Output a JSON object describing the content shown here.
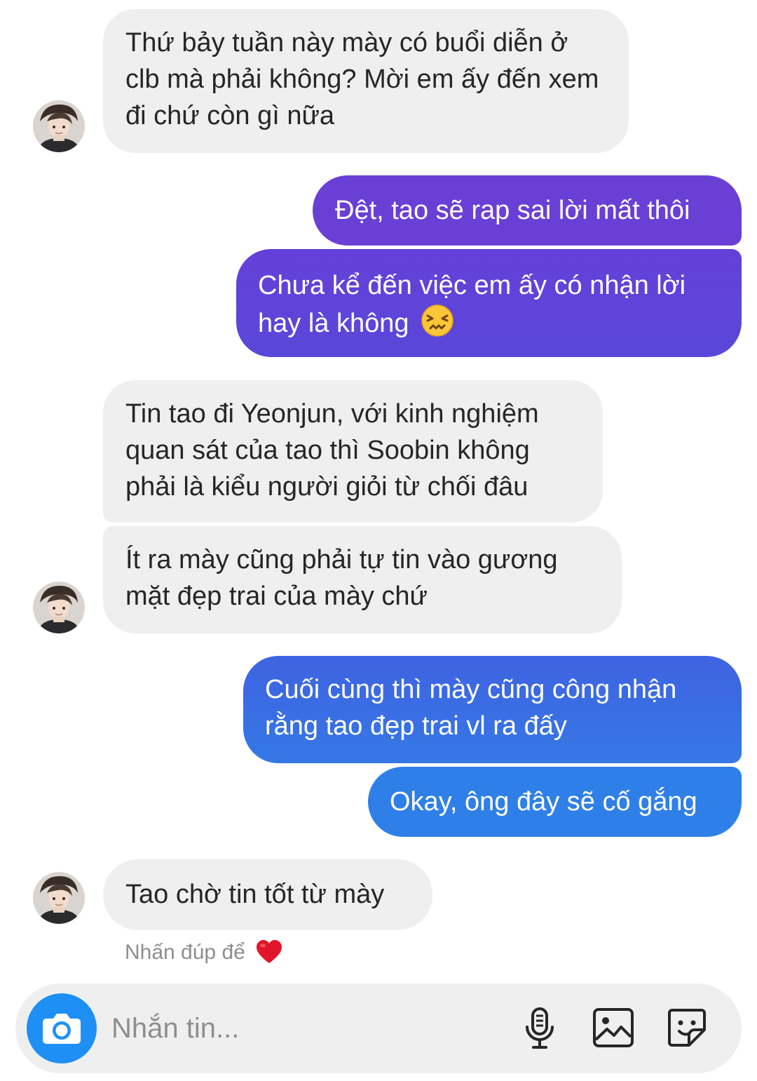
{
  "messages": [
    {
      "text": "Thứ bảy tuần này mày có buổi diễn ở clb mà phải không? Mời em ấy đến xem đi chứ còn gì nữa"
    },
    {
      "text": "Đệt, tao sẽ rap sai lời mất thôi"
    },
    {
      "text": "Chưa kể đến việc em ấy có nhận lời hay là không",
      "emoji": "confounded-face"
    },
    {
      "text": "Tin tao đi Yeonjun, với kinh nghiệm quan sát của tao thì Soobin không phải là kiểu người giỏi từ chối đâu"
    },
    {
      "text": "Ít ra mày cũng phải tự tin vào gương mặt đẹp trai của mày chứ"
    },
    {
      "text": "Cuối cùng thì mày cũng công nhận rằng tao đẹp trai vl ra đấy"
    },
    {
      "text": "Okay, ông đây sẽ cố gắng"
    },
    {
      "text": "Tao chờ tin tốt từ mày"
    }
  ],
  "double_tap_hint": "Nhấn đúp để",
  "composer": {
    "placeholder": "Nhắn tin...",
    "icons": [
      "camera-icon",
      "microphone-icon",
      "gallery-icon",
      "sticker-icon"
    ]
  },
  "colors": {
    "incoming_bubble": "#efefef",
    "outgoing_purple": "#6a3fd6",
    "outgoing_blue": "#3578e5",
    "camera_button": "#1e8ff5",
    "heart": "#e0162b"
  }
}
